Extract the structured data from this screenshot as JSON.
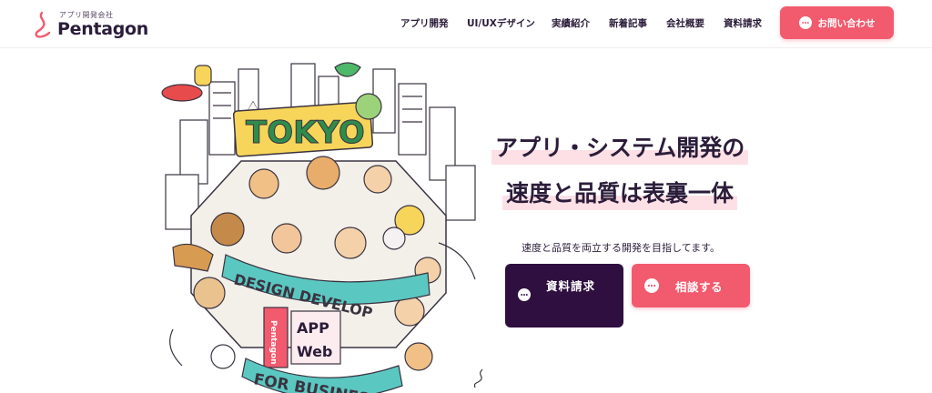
{
  "brand": {
    "tagline": "アプリ開発会社",
    "name": "Pentagon"
  },
  "nav": {
    "items": [
      {
        "label": "アプリ開発"
      },
      {
        "label": "UI/UXデザイン"
      },
      {
        "label": "実績紹介"
      },
      {
        "label": "新着記事"
      },
      {
        "label": "会社概要"
      },
      {
        "label": "資料請求"
      }
    ],
    "contact_label": "お問い合わせ"
  },
  "illustration": {
    "signs": [
      "TOKYO",
      "DESIGN DEVELOP",
      "APP",
      "Web",
      "FOR BUSINESS",
      "Pentagon"
    ]
  },
  "hero": {
    "headline_line1": "アプリ・システム開発の",
    "headline_line2": "速度と品質は表裏一体",
    "lead": "速度と品質を両立する開発を目指してます。",
    "doc_button_label": "資料請求",
    "consult_button_label": "相談する"
  },
  "colors": {
    "accent": "#f25a6e",
    "dark": "#2e0f40",
    "highlight": "#fde0e6",
    "text": "#2b1d3a"
  }
}
